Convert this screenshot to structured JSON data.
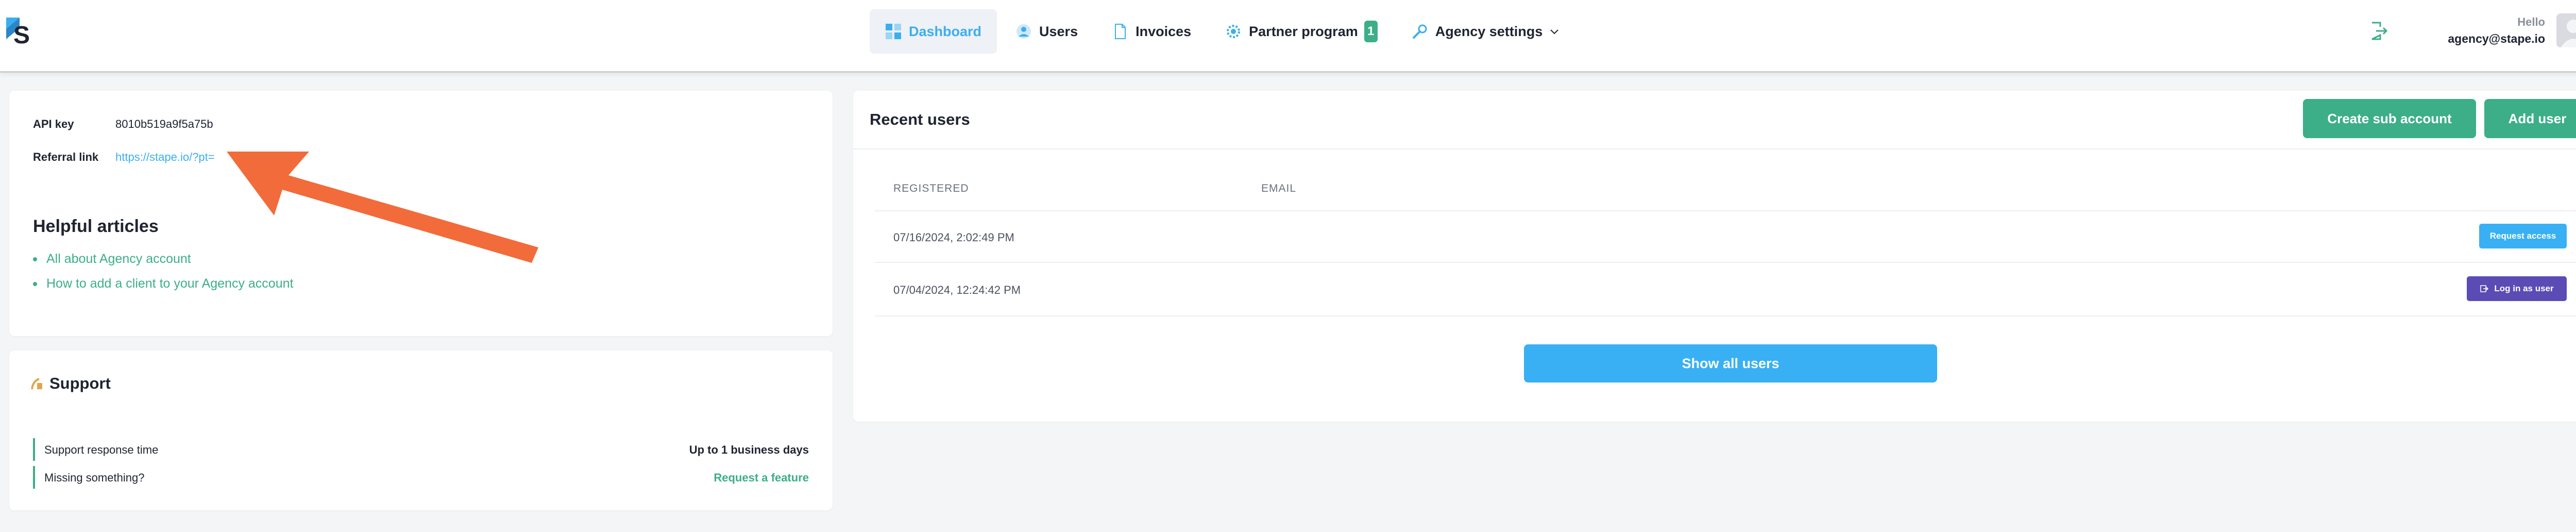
{
  "header": {
    "nav": [
      {
        "label": "Dashboard",
        "icon": "dashboard-icon"
      },
      {
        "label": "Users",
        "icon": "users-icon"
      },
      {
        "label": "Invoices",
        "icon": "invoice-icon"
      },
      {
        "label": "Partner program",
        "icon": "partner-icon",
        "badge": "1"
      },
      {
        "label": "Agency settings",
        "icon": "wrench-icon"
      }
    ],
    "hello": "Hello",
    "email": "agency@stape.io"
  },
  "info": {
    "api_key_label": "API key",
    "api_key_value": "8010b519a9f5a75b",
    "referral_label": "Referral link",
    "referral_value": "https://stape.io/?pt=",
    "articles_title": "Helpful articles",
    "articles": [
      "All about Agency account",
      "How to add a client to your Agency account"
    ]
  },
  "support": {
    "title": "Support",
    "rows": [
      {
        "label": "Support response time",
        "value": "Up to 1 business days"
      },
      {
        "label": "Missing something?",
        "link": "Request a feature"
      }
    ]
  },
  "recent_users": {
    "title": "Recent users",
    "create_button": "Create sub account",
    "add_button": "Add user",
    "columns": [
      "REGISTERED",
      "EMAIL"
    ],
    "rows": [
      {
        "registered": "07/16/2024, 2:02:49 PM",
        "email": "",
        "action": "Request access"
      },
      {
        "registered": "07/04/2024, 12:24:42 PM",
        "email": "",
        "action": "Log in as user"
      }
    ],
    "show_all": "Show all users"
  },
  "colors": {
    "accent_blue": "#38b0f3",
    "accent_green": "#3cae88",
    "purple": "#5a4bb5",
    "annotation_arrow": "#f26b3a"
  }
}
